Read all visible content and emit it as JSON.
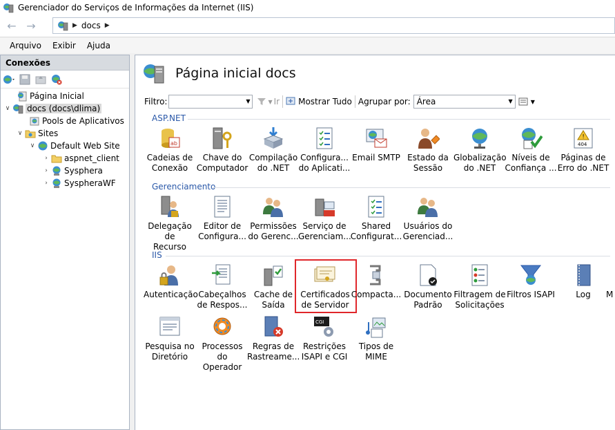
{
  "window": {
    "title": "Gerenciador do Serviços de Informações da Internet (IIS)"
  },
  "address": {
    "crumb": "docs"
  },
  "menu": {
    "items": [
      "Arquivo",
      "Exibir",
      "Ajuda"
    ]
  },
  "connections": {
    "header": "Conexões",
    "tree": [
      {
        "label": "Página Inicial",
        "icon": "home-icon"
      },
      {
        "label": "docs (docs\\dlima)",
        "icon": "server-icon",
        "selected": true
      },
      {
        "label": "Pools de Aplicativos",
        "icon": "app-pool-icon"
      },
      {
        "label": "Sites",
        "icon": "sites-folder-icon"
      },
      {
        "label": "Default Web Site",
        "icon": "globe-icon"
      },
      {
        "label": "aspnet_client",
        "icon": "folder-icon"
      },
      {
        "label": "Sysphera",
        "icon": "web-app-icon"
      },
      {
        "label": "SyspheraWF",
        "icon": "web-app-icon"
      }
    ]
  },
  "main": {
    "title": "Página inicial docs",
    "filter": {
      "label": "Filtro:",
      "go": "Ir",
      "show_all": "Mostrar Tudo",
      "group_by": "Agrupar por:",
      "group_value": "Área"
    },
    "groups": [
      {
        "name": "ASP.NET",
        "features": [
          [
            "Cadeias de",
            "Conexão"
          ],
          [
            "Chave do",
            "Computador"
          ],
          [
            "Compilação",
            "do .NET"
          ],
          [
            "Configura...",
            "do Aplicati..."
          ],
          [
            "Email SMTP",
            ""
          ],
          [
            "Estado da",
            "Sessão"
          ],
          [
            "Globalização",
            "do .NET"
          ],
          [
            "Níveis de",
            "Confiança ..."
          ],
          [
            "Páginas de",
            "Erro do .NET"
          ]
        ]
      },
      {
        "name": "Gerenciamento",
        "features": [
          [
            "Delegação de",
            "Recurso"
          ],
          [
            "Editor de",
            "Configura..."
          ],
          [
            "Permissões",
            "do Gerenc..."
          ],
          [
            "Serviço de",
            "Gerenciam..."
          ],
          [
            "Shared",
            "Configurat..."
          ],
          [
            "Usuários do",
            "Gerenciad..."
          ]
        ]
      },
      {
        "name": "IIS",
        "features": [
          [
            "Autenticação",
            ""
          ],
          [
            "Cabeçalhos",
            "de Respos..."
          ],
          [
            "Cache de",
            "Saída"
          ],
          [
            "Certificados",
            "de Servidor"
          ],
          [
            "Compacta...",
            ""
          ],
          [
            "Documento",
            "Padrão"
          ],
          [
            "Filtragem de",
            "Solicitações"
          ],
          [
            "Filtros ISAPI",
            ""
          ],
          [
            "Log",
            ""
          ],
          [
            "M",
            ""
          ],
          [
            "Pesquisa no",
            "Diretório"
          ],
          [
            "Processos do",
            "Operador"
          ],
          [
            "Regras de",
            "Rastreame..."
          ],
          [
            "Restrições",
            "ISAPI e CGI"
          ],
          [
            "Tipos de",
            "MIME"
          ]
        ]
      }
    ],
    "selected_feature": "Certificados de Servidor"
  },
  "colors": {
    "group_label": "#2a58a8",
    "highlight": "#e0262a"
  }
}
